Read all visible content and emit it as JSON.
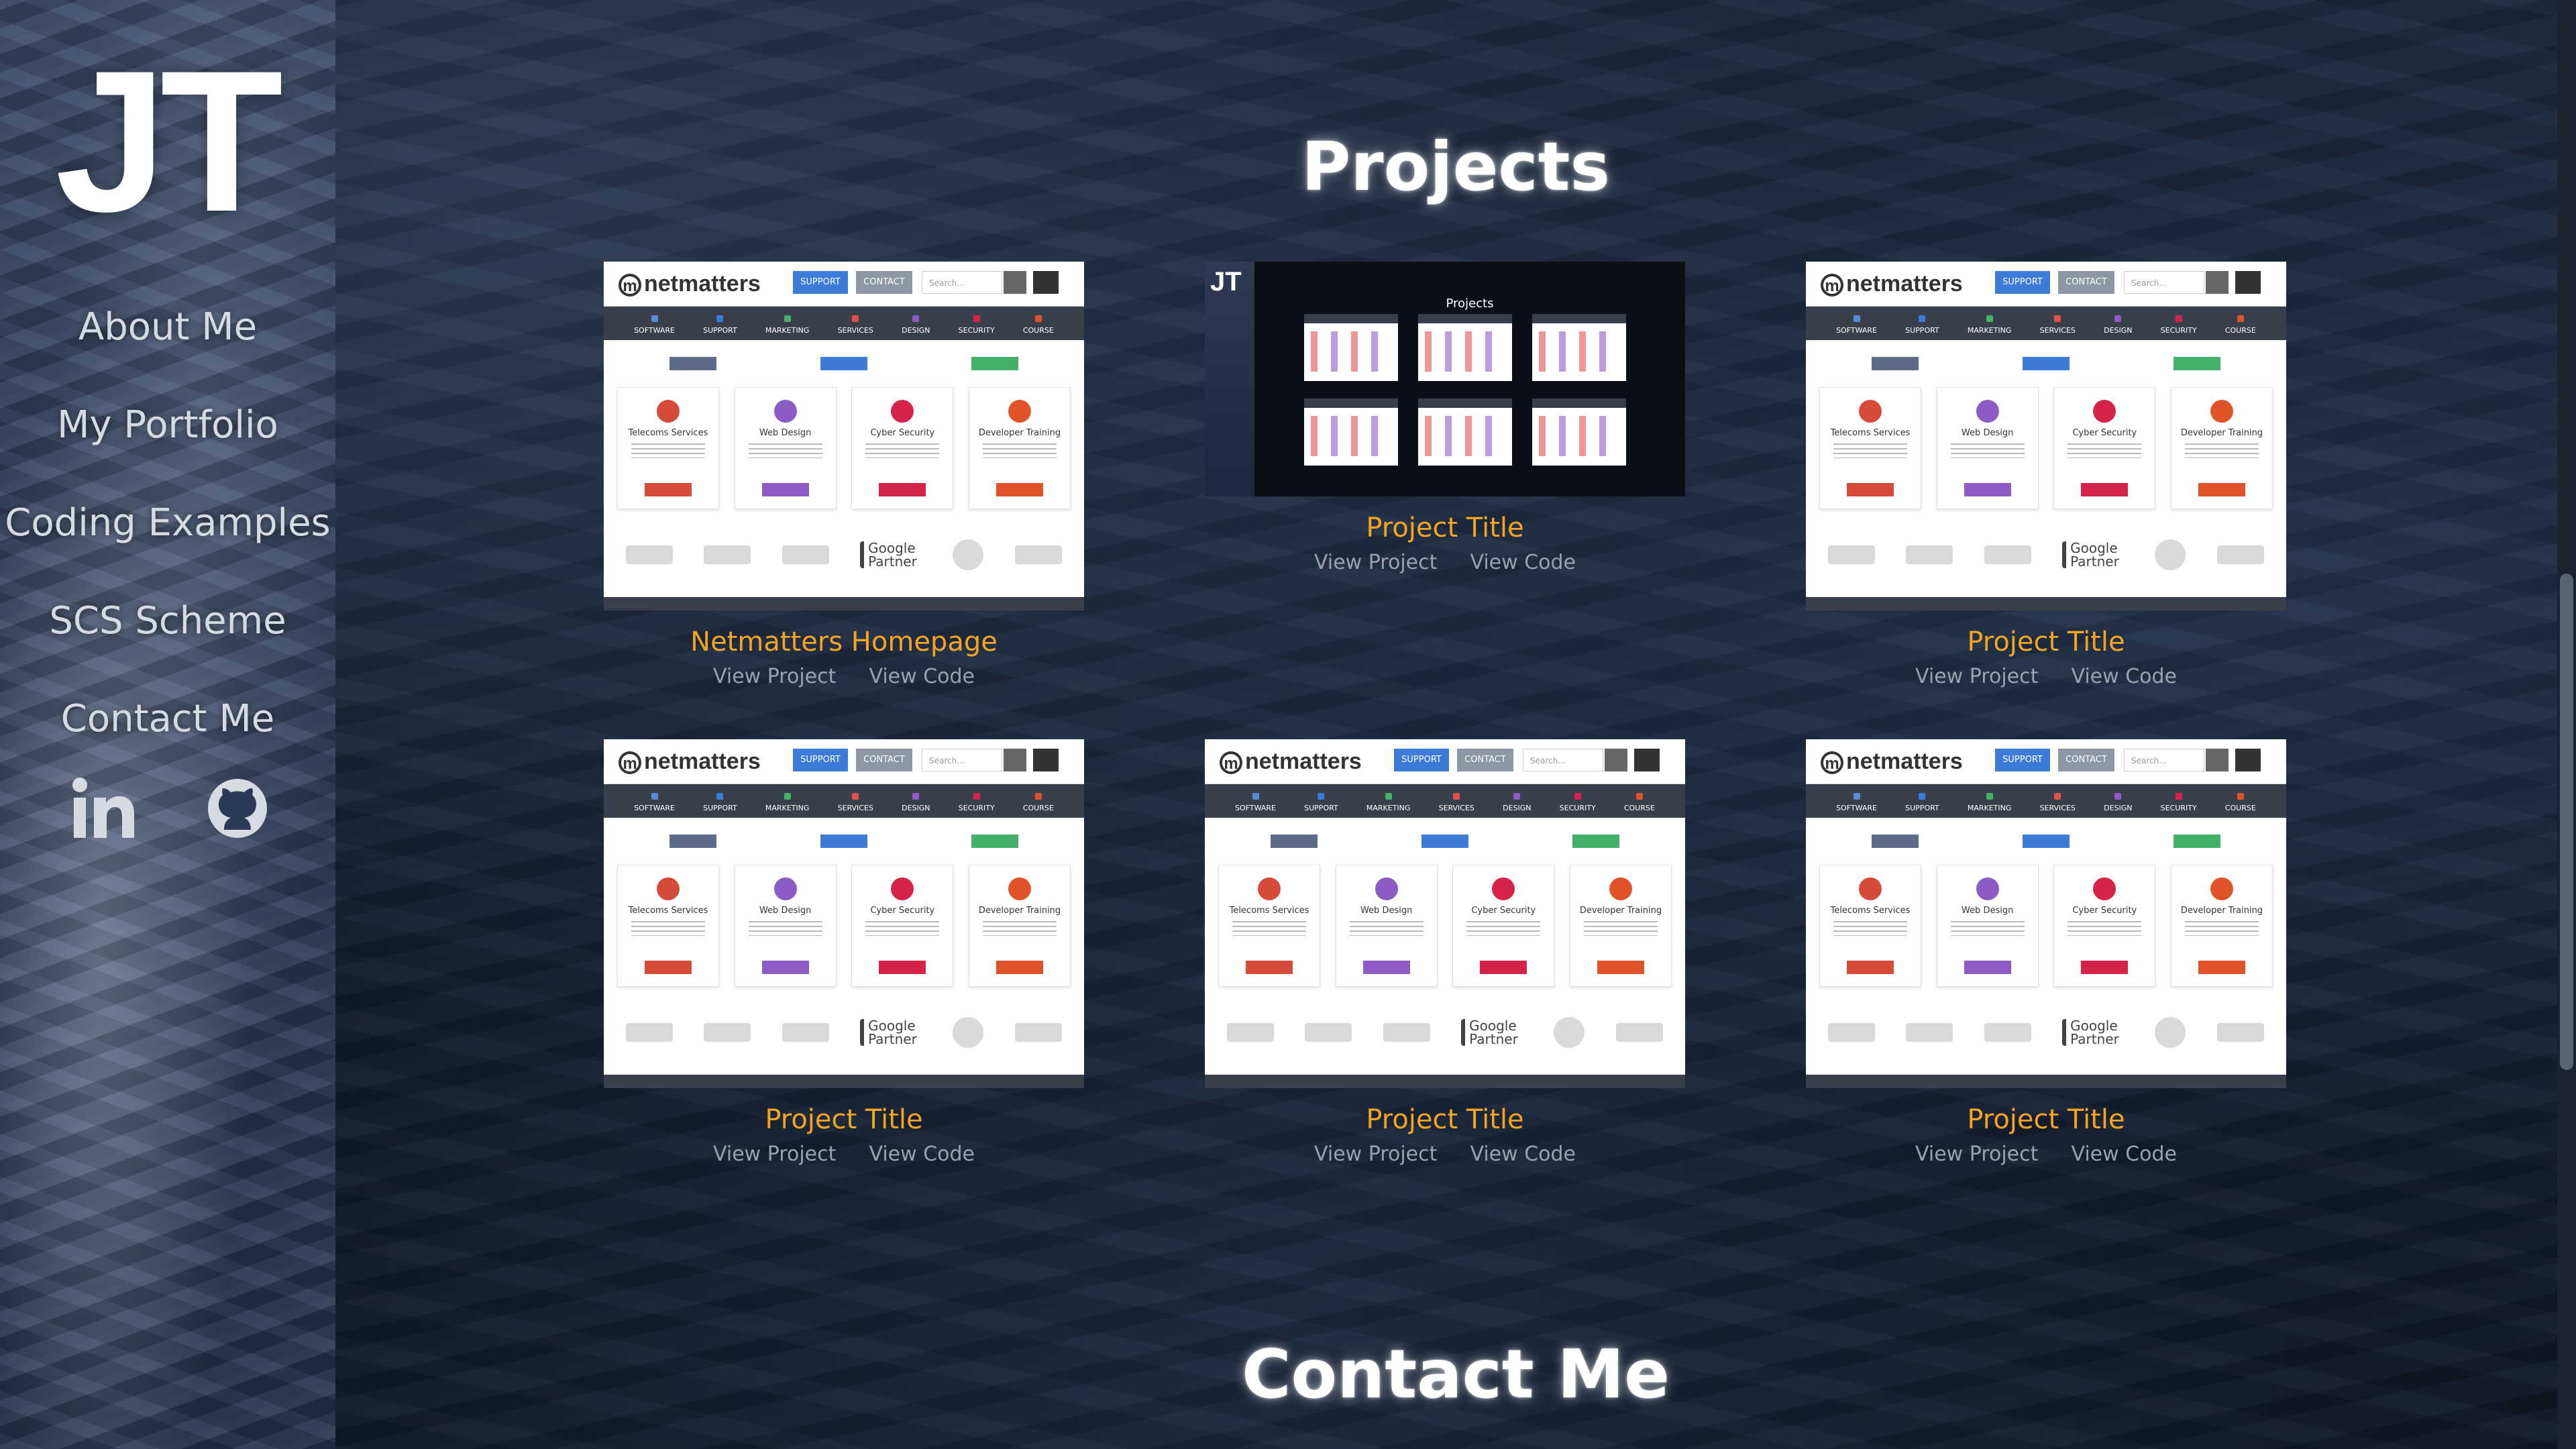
{
  "sidebar": {
    "logo": "JT",
    "nav": [
      {
        "label": "About Me"
      },
      {
        "label": "My Portfolio"
      },
      {
        "label": "Coding Examples"
      },
      {
        "label": "SCS Scheme"
      },
      {
        "label": "Contact Me"
      }
    ],
    "social": [
      {
        "icon": "linkedin-icon",
        "text": "in"
      },
      {
        "icon": "github-icon"
      }
    ]
  },
  "projects": {
    "heading": "Projects",
    "items": [
      {
        "title": "Netmatters Homepage",
        "view": "View Project",
        "code": "View Code"
      },
      {
        "title": "Project Title",
        "view": "View Project",
        "code": "View Code"
      },
      {
        "title": "Project Title",
        "view": "View Project",
        "code": "View Code"
      },
      {
        "title": "Project Title",
        "view": "View Project",
        "code": "View Code"
      },
      {
        "title": "Project Title",
        "view": "View Project",
        "code": "View Code"
      },
      {
        "title": "Project Title",
        "view": "View Project",
        "code": "View Code"
      }
    ]
  },
  "contact": {
    "heading": "Contact Me"
  },
  "thumbnail": {
    "brand": "netmatters",
    "support": "SUPPORT",
    "contact": "CONTACT",
    "search_placeholder": "Search...",
    "nav": [
      "SOFTWARE",
      "SUPPORT",
      "MARKETING",
      "SERVICES",
      "DESIGN",
      "SECURITY",
      "COURSE"
    ],
    "tiles": [
      {
        "title": "Telecoms Services",
        "color": "#d64a3a"
      },
      {
        "title": "Web Design",
        "color": "#8c5cc4"
      },
      {
        "title": "Cyber Security",
        "color": "#d6234a"
      },
      {
        "title": "Developer Training",
        "color": "#e0532a"
      }
    ],
    "partner": "Google Partner",
    "dark_logo": "JT",
    "dark_title": "Projects"
  },
  "colors": {
    "accent": "#f3a422",
    "link": "#9aa2ae",
    "nav": "#d6dbe3"
  }
}
